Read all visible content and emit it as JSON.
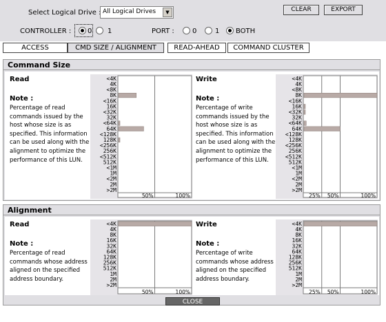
{
  "header": {
    "drive_label": "Select Logical Drive :",
    "drive_value": "All Logical Drives",
    "clear_label": "CLEAR",
    "export_label": "EXPORT",
    "controller_label": "CONTROLLER :",
    "controller_options": [
      "0",
      "1"
    ],
    "controller_selected": "0",
    "port_label": "PORT :",
    "port_options": [
      "0",
      "1",
      "BOTH"
    ],
    "port_selected": "BOTH"
  },
  "tabs": [
    {
      "label": "ACCESS"
    },
    {
      "label": "CMD SIZE / ALIGNMENT"
    },
    {
      "label": "READ-AHEAD"
    },
    {
      "label": "COMMAND CLUSTER"
    }
  ],
  "command_size": {
    "title": "Command Size",
    "read": {
      "heading": "Read",
      "note_title": "Note :",
      "note": "Percentage of read commands issued by the host whose size is as specified. This information can be used along with the alignment to optimize the performance of this LUN."
    },
    "write": {
      "heading": "Write",
      "note_title": "Note :",
      "note": "Percentage of write commands issued by the host whose size is as specified. This information can be used along with the alignment to optimize the performance of this LUN."
    }
  },
  "alignment": {
    "title": "Alignment",
    "read": {
      "heading": "Read",
      "note_title": "Note :",
      "note": "Percentage of read commands whose address aligned on the specified address boundary."
    },
    "write": {
      "heading": "Write",
      "note_title": "Note :",
      "note": "Percentage of write commands whose address aligned on the specified address boundary."
    }
  },
  "close_label": "CLOSE",
  "chart_data": [
    {
      "id": "cmd-read",
      "type": "bar",
      "orientation": "horizontal",
      "categories": [
        "<4K",
        "4K",
        "<8K",
        "8K",
        "<16K",
        "16K",
        "<32K",
        "32K",
        "<64K",
        "64K",
        "<128K",
        "128K",
        "<256K",
        "256K",
        "<512K",
        "512K",
        "<1M",
        "1M",
        "<2M",
        "2M",
        ">2M"
      ],
      "values": [
        0,
        0,
        0,
        25,
        0,
        0,
        0,
        0,
        1,
        35,
        0,
        1,
        0,
        0,
        0,
        0,
        0,
        0,
        0,
        0,
        0
      ],
      "xticks": [
        "50%",
        "100%"
      ],
      "xlim": [
        0,
        100
      ],
      "bar_color": "#b8aaa6"
    },
    {
      "id": "cmd-write",
      "type": "bar",
      "orientation": "horizontal",
      "categories": [
        "<4K",
        "4K",
        "<8K",
        "8K",
        "<16K",
        "16K",
        "<32K",
        "32K",
        "<64K",
        "64K",
        "<128K",
        "128K",
        "<256K",
        "256K",
        "<512K",
        "512K",
        "<1M",
        "1M",
        "<2M",
        "2M",
        ">2M"
      ],
      "values": [
        0,
        0,
        0,
        100,
        0,
        1,
        2,
        0,
        4,
        50,
        0,
        0,
        0,
        0,
        0,
        0,
        0,
        0,
        0,
        0,
        0
      ],
      "xticks": [
        "25%",
        "50%",
        "100%"
      ],
      "xlim": [
        0,
        100
      ],
      "bar_color": "#b8aaa6"
    },
    {
      "id": "align-read",
      "type": "bar",
      "orientation": "horizontal",
      "categories": [
        "<4K",
        "4K",
        "8K",
        "16K",
        "32K",
        "64K",
        "128K",
        "256K",
        "512K",
        "1M",
        "2M",
        ">2M"
      ],
      "values": [
        100,
        0,
        0,
        0,
        0,
        0,
        0,
        0,
        0,
        0,
        0,
        0
      ],
      "xticks": [
        "50%",
        "100%"
      ],
      "xlim": [
        0,
        100
      ],
      "bar_color": "#b8aaa6"
    },
    {
      "id": "align-write",
      "type": "bar",
      "orientation": "horizontal",
      "categories": [
        "<4K",
        "4K",
        "8K",
        "16K",
        "32K",
        "64K",
        "128K",
        "256K",
        "512K",
        "1M",
        "2M",
        ">2M"
      ],
      "values": [
        100,
        0,
        0,
        0,
        0,
        0,
        0,
        0,
        0,
        0,
        0,
        0
      ],
      "xticks": [
        "25%",
        "50%",
        "100%"
      ],
      "xlim": [
        0,
        100
      ],
      "bar_color": "#b8aaa6"
    }
  ]
}
